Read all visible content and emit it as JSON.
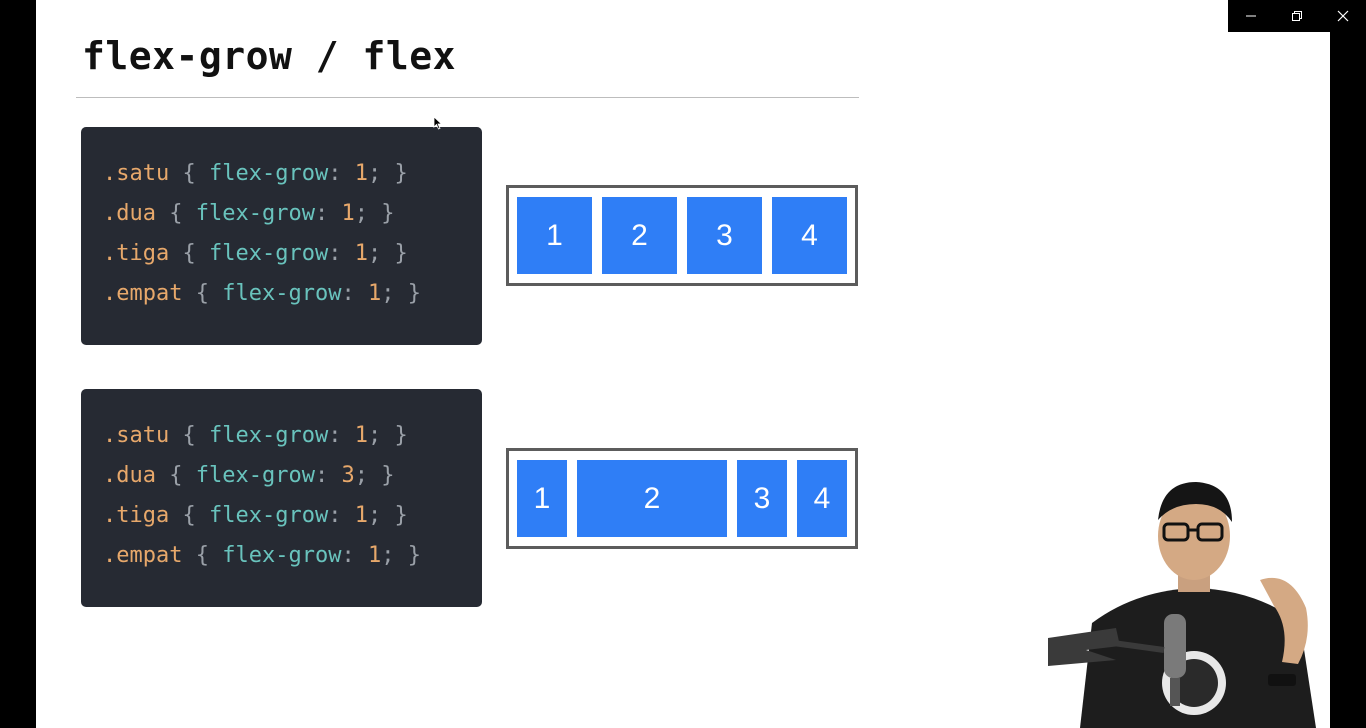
{
  "slide": {
    "title": "flex-grow / flex"
  },
  "examples": [
    {
      "code": [
        {
          "selector": ".satu",
          "property": "flex-grow",
          "value": "1"
        },
        {
          "selector": ".dua",
          "property": "flex-grow",
          "value": "1"
        },
        {
          "selector": ".tiga",
          "property": "flex-grow",
          "value": "1"
        },
        {
          "selector": ".empat",
          "property": "flex-grow",
          "value": "1"
        }
      ],
      "demo": [
        {
          "label": "1",
          "grow": 1
        },
        {
          "label": "2",
          "grow": 1
        },
        {
          "label": "3",
          "grow": 1
        },
        {
          "label": "4",
          "grow": 1
        }
      ]
    },
    {
      "code": [
        {
          "selector": ".satu",
          "property": "flex-grow",
          "value": "1"
        },
        {
          "selector": ".dua",
          "property": "flex-grow",
          "value": "3"
        },
        {
          "selector": ".tiga",
          "property": "flex-grow",
          "value": "1"
        },
        {
          "selector": ".empat",
          "property": "flex-grow",
          "value": "1"
        }
      ],
      "demo": [
        {
          "label": "1",
          "grow": 1
        },
        {
          "label": "2",
          "grow": 3
        },
        {
          "label": "3",
          "grow": 1
        },
        {
          "label": "4",
          "grow": 1
        }
      ]
    }
  ],
  "window_controls": {
    "minimize_icon": "minimize-icon",
    "restore_icon": "restore-icon",
    "close_icon": "close-icon"
  },
  "colors": {
    "accent_blue": "#2f7ef6",
    "code_bg": "#262a33",
    "code_property": "#69c3bd",
    "code_selector": "#e7a86b"
  }
}
